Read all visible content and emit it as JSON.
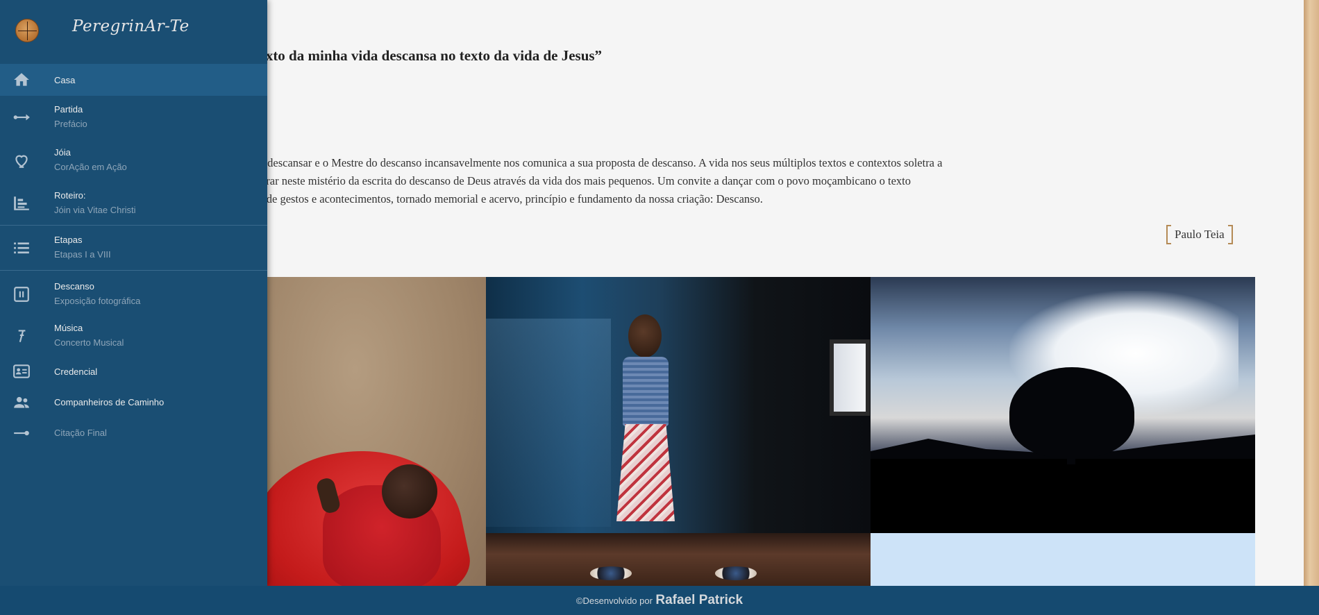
{
  "brand": {
    "name": "PeregrinAr-Te",
    "logo_icon": "compass-icon"
  },
  "sidebar": {
    "items": [
      {
        "title": "Casa",
        "subtitle": "",
        "icon": "home-icon",
        "active": true
      },
      {
        "title": "Partida",
        "subtitle": "Prefácio",
        "icon": "arrow-line-icon",
        "active": false
      },
      {
        "title": "Jóia",
        "subtitle": "CorAção em Ação",
        "icon": "heart-icon",
        "active": false
      },
      {
        "title": "Roteiro:",
        "subtitle": "Jóin via Vitae Christi",
        "icon": "route-icon",
        "active": false
      },
      {
        "title": "Etapas",
        "subtitle": "Etapas I a VIII",
        "icon": "list-icon",
        "active": false
      },
      {
        "title": "Descanso",
        "subtitle": "Exposição fotográfica",
        "icon": "pause-box-icon",
        "active": false
      },
      {
        "title": "Música",
        "subtitle": "Concerto Musical",
        "icon": "music-note-icon",
        "active": false
      },
      {
        "title": "Credencial",
        "subtitle": "",
        "icon": "id-card-icon",
        "active": false
      },
      {
        "title": "Companheiros de Caminho",
        "subtitle": "",
        "icon": "people-icon",
        "active": false
      },
      {
        "title": "Citação Final",
        "subtitle": "",
        "icon": "line-end-icon",
        "active": false
      }
    ]
  },
  "main": {
    "quote": "o o texto da minha vida descansa no texto da vida de Jesus”",
    "paragraph_lines": [
      "Linguagem de descanso. Fomos criados para descansar e o Mestre do descanso incansavelmente nos comunica a sua proposta de descanso. A vida nos seus múltiplos textos e contextos soletra a",
      "nte Exposição Fotográfica é um convite a entrar neste mistério da escrita do descanso de Deus através da vida dos mais pequenos. Um convite a dançar com o povo moçambicano o texto",
      "deixou como legado. Um “Evangelho”, feito de gestos e acontecimentos, tornado memorial e acervo, princípio e fundamento da nossa criação: Descanso."
    ],
    "author": "Paulo Teia"
  },
  "footer": {
    "prefix": "©Desenvolvido por",
    "developer": "Rafael Patrick"
  },
  "colors": {
    "sidebar": "#1a4e73",
    "active_item": "#225d87",
    "footer": "#154a70",
    "accent_bracket": "#b48a55"
  }
}
